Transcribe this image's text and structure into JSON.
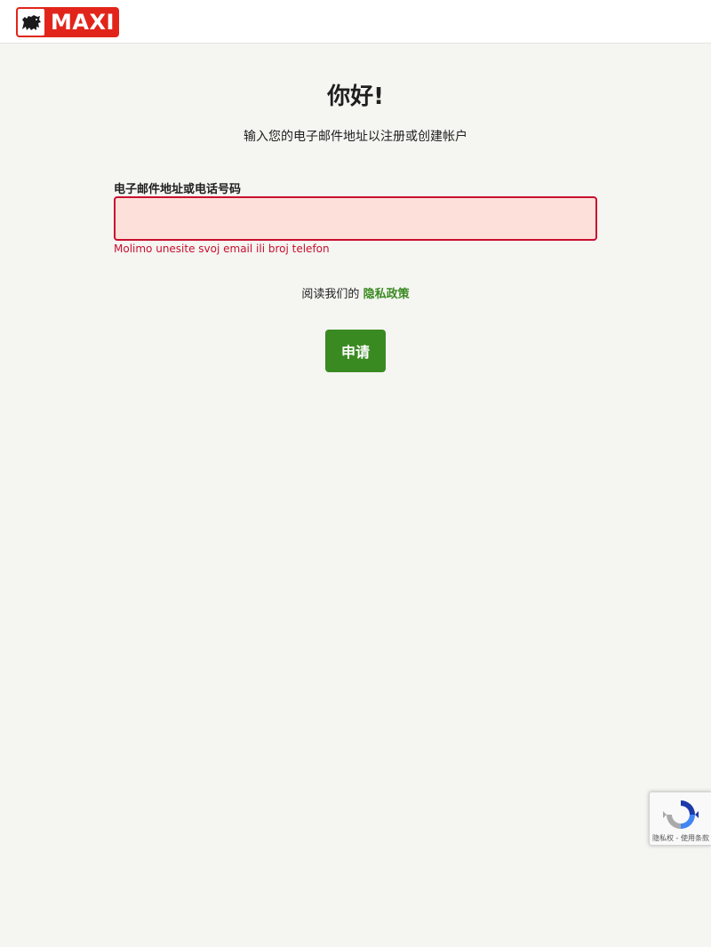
{
  "header": {
    "logo_text": "MAXI",
    "brand_color": "#e1251b"
  },
  "main": {
    "title": "你好!",
    "subtitle": "输入您的电子邮件地址以注册或创建帐户",
    "field": {
      "label": "电子邮件地址或电话号码",
      "value": "",
      "placeholder": "",
      "error": "Molimo unesite svoj email ili broj telefon"
    },
    "policy": {
      "prefix": "阅读我们的 ",
      "link_label": "隐私政策"
    },
    "submit_label": "申请"
  },
  "recaptcha": {
    "terms": "隐私权 - 使用条款"
  },
  "colors": {
    "accent_green": "#3a8a22",
    "error_red": "#c8102e",
    "input_error_bg": "#fde0da",
    "page_bg": "#f5f5f2"
  }
}
